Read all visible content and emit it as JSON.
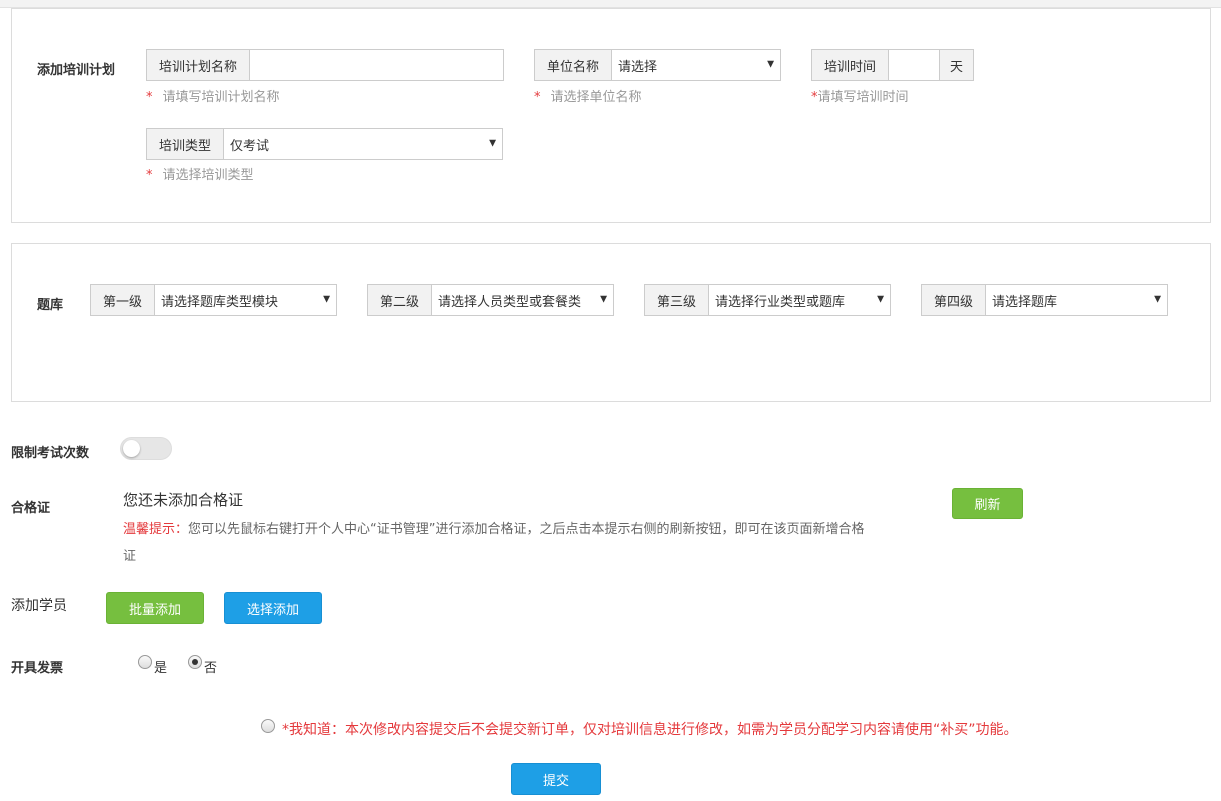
{
  "plan": {
    "section_label": "添加培训计划",
    "name_addon": "培训计划名称",
    "name_value": "",
    "name_hint": "请填写培训计划名称",
    "unit_addon": "单位名称",
    "unit_value": "请选择",
    "unit_hint": "请选择单位名称",
    "time_addon": "培训时间",
    "time_value": "",
    "time_suffix": "天",
    "time_hint": "请填写培训时间",
    "type_addon": "培训类型",
    "type_value": "仅考试",
    "type_hint": "请选择培训类型",
    "required_mark": "*"
  },
  "bank": {
    "section_label": "题库",
    "levels": [
      {
        "addon": "第一级",
        "value": "请选择题库类型模块"
      },
      {
        "addon": "第二级",
        "value": "请选择人员类型或套餐类"
      },
      {
        "addon": "第三级",
        "value": "请选择行业类型或题库"
      },
      {
        "addon": "第四级",
        "value": "请选择题库"
      }
    ]
  },
  "limit": {
    "label": "限制考试次数",
    "enabled": false
  },
  "cert": {
    "label": "合格证",
    "empty_text": "您还未添加合格证",
    "tip_prefix": "温馨提示：",
    "tip_line1": "您可以先鼠标右键打开个人中心“证书管理”进行添加合格证，之后点击本提示右侧的刷新按钮，即可在该页面新增合格",
    "tip_line2": "证",
    "refresh_label": "刷新"
  },
  "students": {
    "label": "添加学员",
    "batch_label": "批量添加",
    "select_label": "选择添加"
  },
  "invoice": {
    "label": "开具发票",
    "yes_label": "是",
    "no_label": "否",
    "selected": "否"
  },
  "notice": {
    "text": "*我知道：本次修改内容提交后不会提交新订单，仅对培训信息进行修改，如需为学员分配学习内容请使用“补买”功能。",
    "checked": false
  },
  "submit_label": "提交",
  "colors": {
    "green": "#76bf3f",
    "blue": "#1e9fe6",
    "red": "#e4393c"
  }
}
